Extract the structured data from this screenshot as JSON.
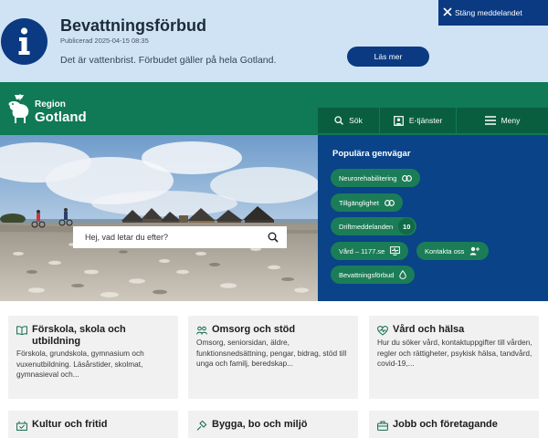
{
  "alert": {
    "icon": "info-icon",
    "title": "Bevattningsförbud",
    "published": "Publicerad 2025-04-15 08:35",
    "text": "Det är vattenbrist. Förbudet gäller på hela Gotland.",
    "close_label": "Stäng meddelandet",
    "read_more_label": "Läs mer"
  },
  "header": {
    "logo_region": "Region",
    "logo_name": "Gotland",
    "nav": {
      "search_label": "Sök",
      "etjanster_label": "E-tjänster",
      "menu_label": "Meny"
    }
  },
  "hero": {
    "search_placeholder": "Hej, vad letar du efter?"
  },
  "shortcuts": {
    "title": "Populära genvägar",
    "items": [
      {
        "label": "Neurorehabilitering",
        "icon": "link-icon"
      },
      {
        "label": "Tillgänglighet",
        "icon": "link-icon"
      },
      {
        "label": "Driftmeddelanden",
        "badge": "10"
      },
      {
        "label": "Vård – 1177.se",
        "icon": "heart-monitor-icon"
      },
      {
        "label": "Kontakta oss",
        "icon": "contact-icon"
      },
      {
        "label": "Bevattningsförbud",
        "icon": "water-drop-icon"
      }
    ]
  },
  "cards": [
    {
      "title": "Förskola, skola och utbildning",
      "text": "Förskola, grundskola, gymnasium och vuxenutbildning. Läsårstider, skolmat, gymnasieval och...",
      "icon": "book-icon"
    },
    {
      "title": "Omsorg och stöd",
      "text": "Omsorg, seniorsidan, äldre, funktionsnedsättning, pengar, bidrag, stöd till unga och familj, beredskap...",
      "icon": "people-icon"
    },
    {
      "title": "Vård och hälsa",
      "text": "Hur du söker vård, kontaktuppgifter till vården, regler och rättigheter, psykisk hälsa, tandvård, covid-19,...",
      "icon": "heart-pulse-icon"
    },
    {
      "title": "Kultur och fritid",
      "text": "",
      "icon": "culture-icon"
    },
    {
      "title": "Bygga, bo och miljö",
      "text": "",
      "icon": "build-icon"
    },
    {
      "title": "Jobb och företagande",
      "text": "",
      "icon": "briefcase-icon"
    }
  ]
}
